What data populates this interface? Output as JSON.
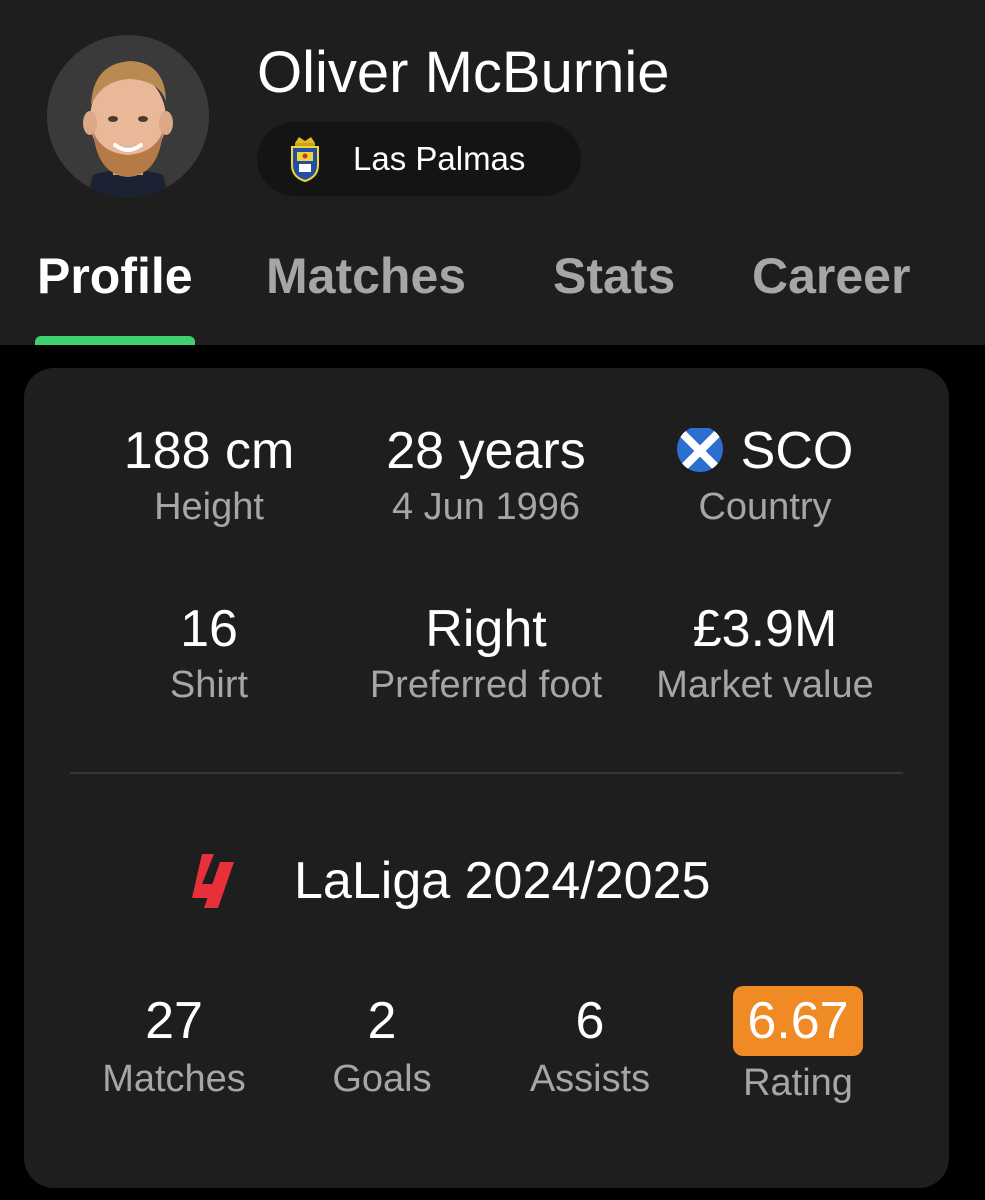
{
  "player": {
    "name": "Oliver McBurnie",
    "team": "Las Palmas"
  },
  "tabs": [
    {
      "label": "Profile",
      "active": true
    },
    {
      "label": "Matches",
      "active": false
    },
    {
      "label": "Stats",
      "active": false
    },
    {
      "label": "Career",
      "active": false
    }
  ],
  "info": {
    "height": {
      "value": "188 cm",
      "label": "Height"
    },
    "age": {
      "value": "28 years",
      "label": "4 Jun 1996"
    },
    "country": {
      "value": "SCO",
      "label": "Country",
      "flag_icon": "scotland-flag-icon"
    },
    "shirt": {
      "value": "16",
      "label": "Shirt"
    },
    "foot": {
      "value": "Right",
      "label": "Preferred foot"
    },
    "market": {
      "value": "£3.9M",
      "label": "Market value"
    }
  },
  "league": {
    "icon": "laliga-logo-icon",
    "title": "LaLiga 2024/2025"
  },
  "season_stats": [
    {
      "value": "27",
      "label": "Matches"
    },
    {
      "value": "2",
      "label": "Goals"
    },
    {
      "value": "6",
      "label": "Assists"
    },
    {
      "value": "6.67",
      "label": "Rating"
    }
  ],
  "colors": {
    "accent": "#3fd16f",
    "rating": "#f08a24",
    "card_bg": "#1e1e1e",
    "page_bg": "#000000",
    "muted_text": "#a6a6a6",
    "league_red": "#e8303b"
  }
}
